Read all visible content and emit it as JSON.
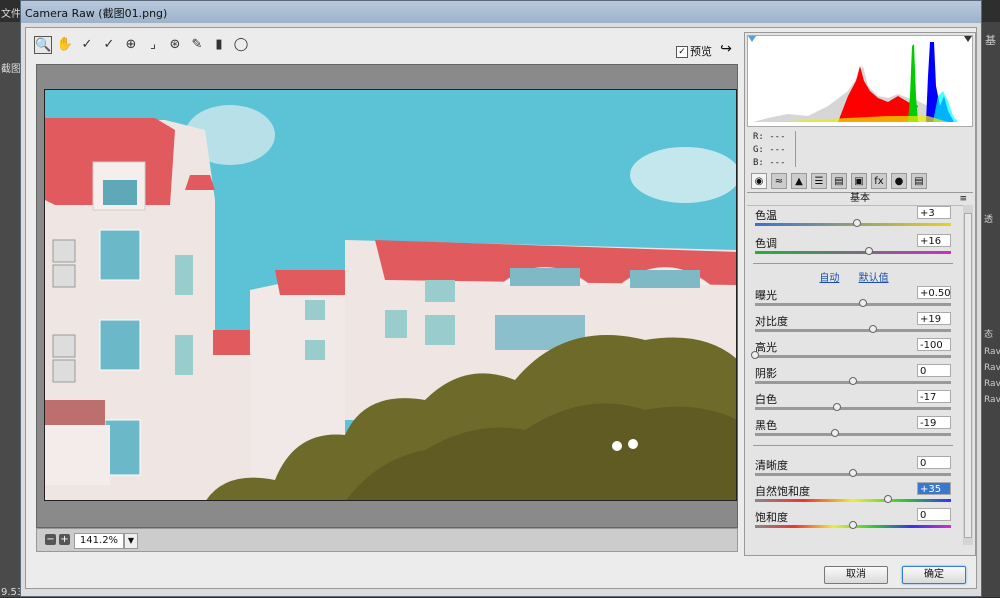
{
  "window": {
    "title": "Camera Raw (截图01.png)"
  },
  "host_app": {
    "left_labels": [
      "文件",
      "截图",
      "9.53"
    ],
    "right_labels": [
      "基",
      "透",
      "态",
      "Rav",
      "Rav",
      "Rav",
      "Rav"
    ]
  },
  "toolbar": {
    "tools": [
      "zoom-icon",
      "hand-icon",
      "white-balance-icon",
      "color-sampler-icon",
      "targeted-adjust-icon",
      "crop-icon",
      "spot-removal-icon",
      "redeye-icon",
      "adjustment-brush-icon",
      "graduated-filter-icon",
      "radial-filter-icon"
    ],
    "preview_label": "预览",
    "preview_checked": true
  },
  "zoom": {
    "value": "141.2%"
  },
  "rgb_readout": {
    "r": "R:  ---",
    "g": "G:  ---",
    "b": "B:  ---"
  },
  "panel": {
    "title": "基本",
    "tabs": [
      "basic-icon",
      "tone-curve-icon",
      "detail-icon",
      "hsl-icon",
      "split-tone-icon",
      "lens-icon",
      "fx-icon",
      "camera-calibration-icon",
      "presets-icon"
    ],
    "auto_label": "自动",
    "default_label": "默认值",
    "sliders": [
      {
        "label": "色温",
        "value": "+3",
        "pos": 0.52
      },
      {
        "label": "色调",
        "value": "+16",
        "pos": 0.58
      },
      {
        "label": "曝光",
        "value": "+0.50",
        "pos": 0.55
      },
      {
        "label": "对比度",
        "value": "+19",
        "pos": 0.6
      },
      {
        "label": "高光",
        "value": "-100",
        "pos": 0.0
      },
      {
        "label": "阴影",
        "value": "0",
        "pos": 0.5
      },
      {
        "label": "白色",
        "value": "-17",
        "pos": 0.42
      },
      {
        "label": "黑色",
        "value": "-19",
        "pos": 0.41
      },
      {
        "label": "清晰度",
        "value": "0",
        "pos": 0.5
      },
      {
        "label": "自然饱和度",
        "value": "+35",
        "pos": 0.68
      },
      {
        "label": "饱和度",
        "value": "0",
        "pos": 0.5
      }
    ]
  },
  "buttons": {
    "cancel": "取消",
    "ok": "确定"
  },
  "colors": {
    "sky": "#5cc3d6",
    "roof": "#e05a5e",
    "wall": "#efe6e4",
    "tree": "#6e6a2a"
  }
}
